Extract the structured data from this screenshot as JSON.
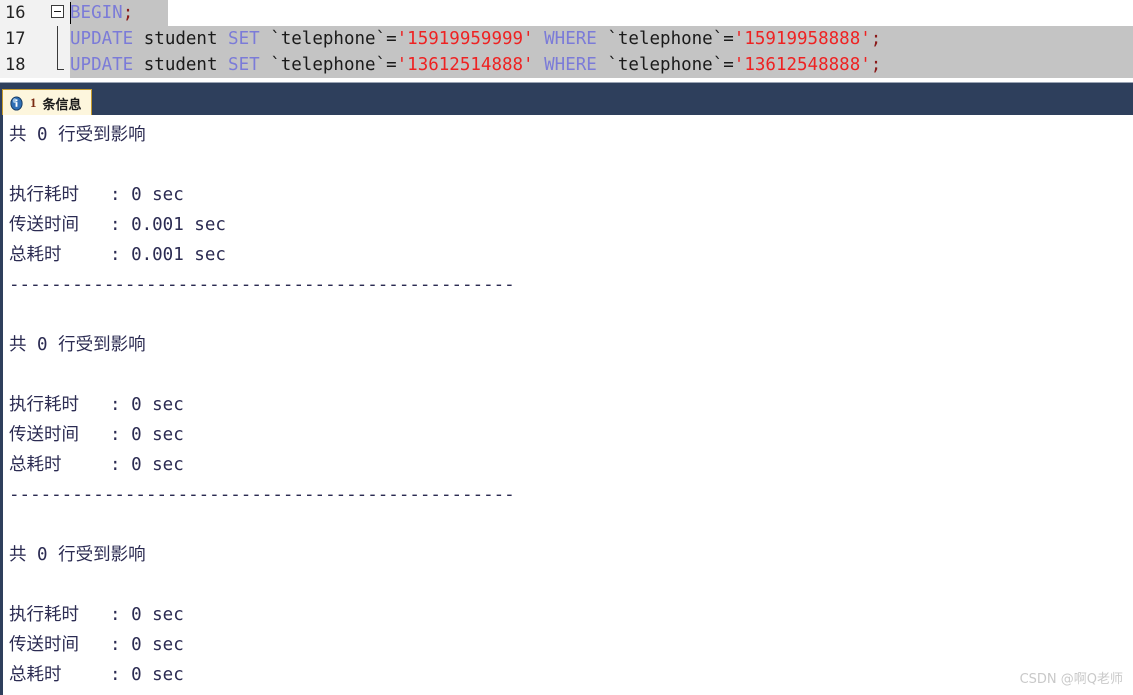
{
  "editor": {
    "lines": [
      {
        "number": "16",
        "fold": "collapse-box",
        "selected_text": "BEGIN;",
        "tokens": [
          {
            "t": "BEGIN",
            "c": "kw"
          },
          {
            "t": ";",
            "c": "punct"
          }
        ]
      },
      {
        "number": "17",
        "fold": "fold-line",
        "tokens": [
          {
            "t": "UPDATE",
            "c": "kw"
          },
          {
            "t": " student ",
            "c": "plain"
          },
          {
            "t": "SET",
            "c": "kw"
          },
          {
            "t": " `telephone`=",
            "c": "plain"
          },
          {
            "t": "'15919959999'",
            "c": "str"
          },
          {
            "t": " ",
            "c": "plain"
          },
          {
            "t": "WHERE",
            "c": "kw"
          },
          {
            "t": " `telephone`=",
            "c": "plain"
          },
          {
            "t": "'15919958888'",
            "c": "str"
          },
          {
            "t": ";",
            "c": "punct"
          }
        ]
      },
      {
        "number": "18",
        "fold": "fold-line-end",
        "tokens": [
          {
            "t": "UPDATE",
            "c": "kw"
          },
          {
            "t": " student ",
            "c": "plain"
          },
          {
            "t": "SET",
            "c": "kw"
          },
          {
            "t": " `telephone`=",
            "c": "plain"
          },
          {
            "t": "'13612514888'",
            "c": "str"
          },
          {
            "t": " ",
            "c": "plain"
          },
          {
            "t": "WHERE",
            "c": "kw"
          },
          {
            "t": " `telephone`=",
            "c": "plain"
          },
          {
            "t": "'13612548888'",
            "c": "str"
          },
          {
            "t": ";",
            "c": "punct"
          }
        ]
      }
    ]
  },
  "tab_bar": {
    "active_tab": {
      "icon": "info-icon",
      "count": "1",
      "label": "条信息"
    }
  },
  "results": {
    "blocks": [
      {
        "affected": "共 0 行受到影响",
        "rows": [
          {
            "label": "执行耗时",
            "value": ": 0 sec"
          },
          {
            "label": "传送时间",
            "value": ": 0.001 sec"
          },
          {
            "label": "总耗时",
            "value": ": 0.001 sec"
          }
        ],
        "separator": "------------------------------------------------"
      },
      {
        "affected": "共 0 行受到影响",
        "rows": [
          {
            "label": "执行耗时",
            "value": ": 0 sec"
          },
          {
            "label": "传送时间",
            "value": ": 0 sec"
          },
          {
            "label": "总耗时",
            "value": ": 0 sec"
          }
        ],
        "separator": "------------------------------------------------"
      },
      {
        "affected": "共 0 行受到影响",
        "rows": [
          {
            "label": "执行耗时",
            "value": ": 0 sec"
          },
          {
            "label": "传送时间",
            "value": ": 0 sec"
          },
          {
            "label": "总耗时",
            "value": ": 0 sec"
          }
        ],
        "separator": ""
      }
    ]
  },
  "watermark": {
    "text": "CSDN @啊Q老师"
  },
  "colors": {
    "tab_bar_bg": "#2e3f5c",
    "active_tab_bg": "#fdf6dd",
    "active_tab_border": "#c49a2e",
    "selection": "#c4c4c4",
    "gutter_bg": "#f2f2f2",
    "keyword": "#7b7bd8",
    "string": "#ee2222",
    "result_text": "#2b2b52",
    "watermark": "#c9c9c9"
  }
}
